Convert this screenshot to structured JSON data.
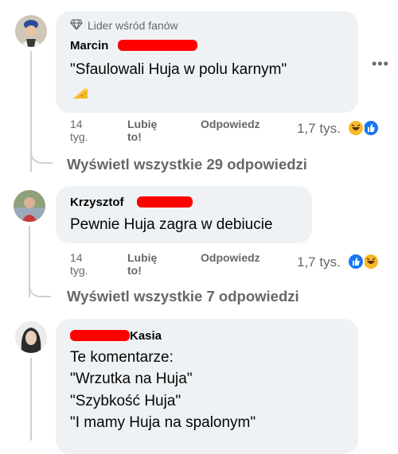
{
  "comments": [
    {
      "badge": "Lider wśród fanów",
      "author_first": "Marcin",
      "text": "\"Sfaulowali Huja w polu karnym\"",
      "time": "14 tyg.",
      "like": "Lubię to!",
      "reply": "Odpowiedz",
      "reactions_count": "1,7 tys.",
      "replies_link": "Wyświetl wszystkie 29 odpowiedzi",
      "reaction_icons": [
        "haha-icon",
        "like-icon"
      ]
    },
    {
      "author_first": "Krzysztof",
      "text": "Pewnie Huja zagra w debiucie",
      "time": "14 tyg.",
      "like": "Lubię to!",
      "reply": "Odpowiedz",
      "reactions_count": "1,7 tys.",
      "replies_link": "Wyświetl wszystkie 7 odpowiedzi",
      "reaction_icons": [
        "like-icon",
        "haha-icon"
      ]
    },
    {
      "author_last": "Kasia",
      "lines": [
        "Te komentarze:",
        "\"Wrzutka na Huja\"",
        "\"Szybkość Huja\"",
        "\"I mamy Huja na spalonym\""
      ]
    }
  ],
  "colors": {
    "bubble": "#eff2f5",
    "secondary_text": "#65676b",
    "like_blue": "#1877f2",
    "haha_yellow": "#f7b928",
    "redaction": "#ff0000"
  }
}
